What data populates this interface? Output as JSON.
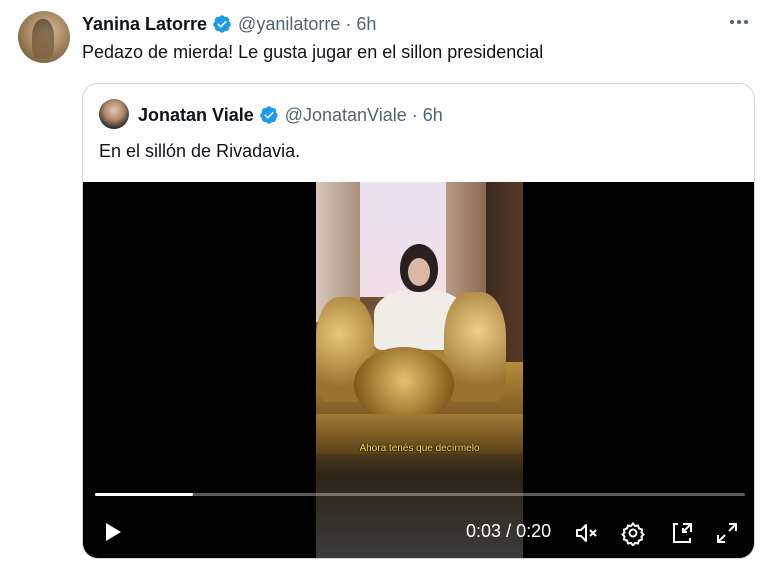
{
  "tweet": {
    "author_name": "Yanina Latorre",
    "author_handle": "@yanilatorre",
    "separator": "·",
    "time": "6h",
    "text": "Pedazo de mierda! Le gusta jugar en el sillon presidencial"
  },
  "quoted": {
    "author_name": "Jonatan Viale",
    "author_handle": "@JonatanViale",
    "separator": "·",
    "time": "6h",
    "text": "En el sillón de Rivadavia.",
    "video": {
      "subtitle": "Ahora tenés que decírmelo",
      "current_time": "0:03",
      "time_separator": "/",
      "duration": "0:20",
      "progress_fraction": 0.15
    }
  },
  "colors": {
    "verified_blue": "#1d9bf0",
    "secondary_text": "#536471",
    "border": "#cfd9de"
  },
  "icons": [
    "verified-badge-icon",
    "more-options-icon",
    "play-icon",
    "mute-icon",
    "settings-icon",
    "picture-in-picture-icon",
    "fullscreen-icon"
  ]
}
